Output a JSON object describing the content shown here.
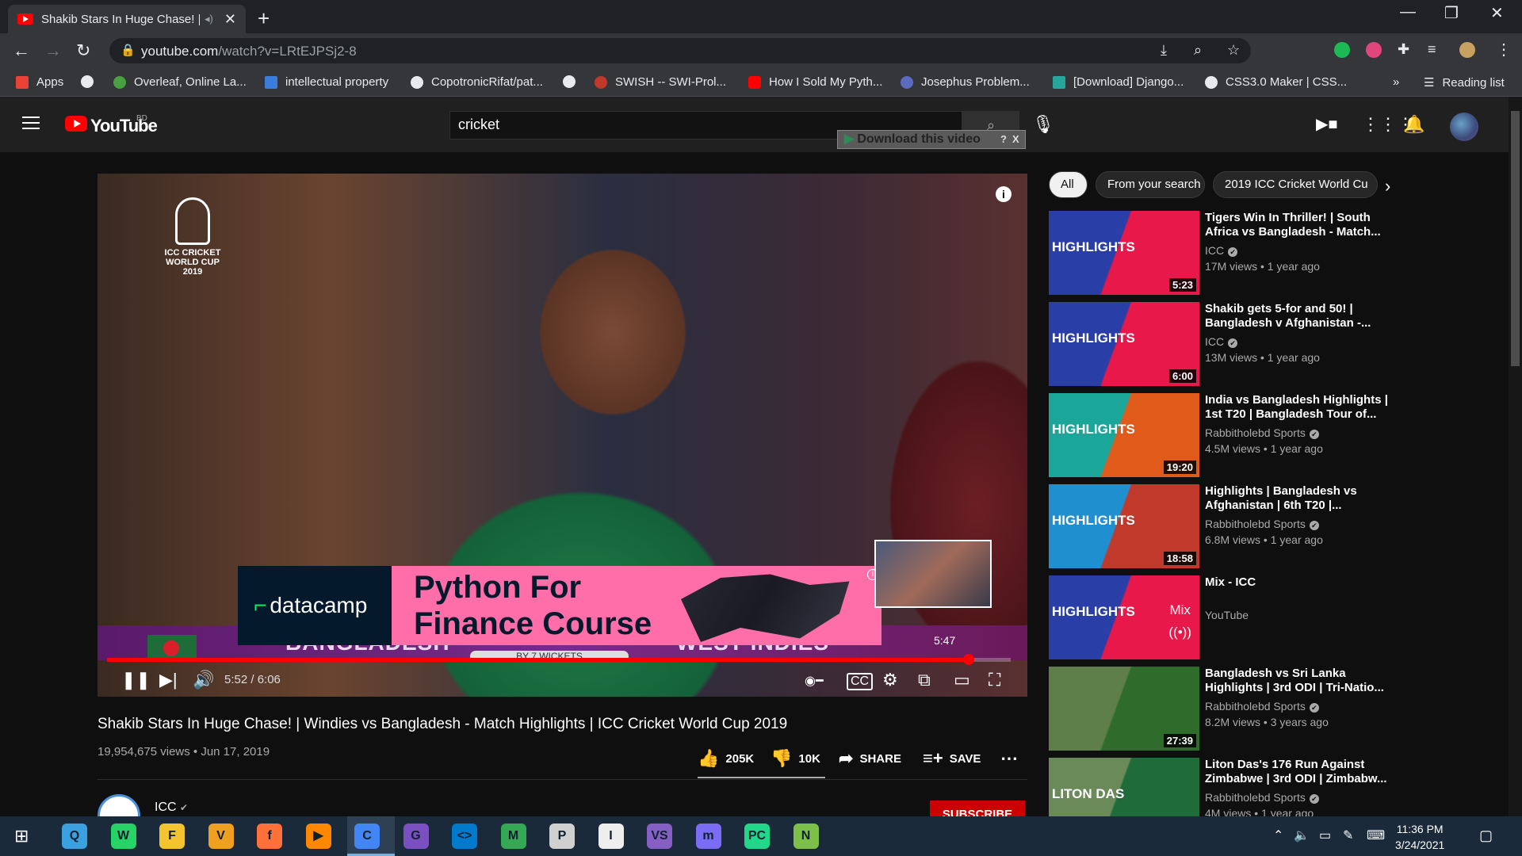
{
  "browser": {
    "tab_title": "Shakib Stars In Huge Chase! |",
    "url_host": "youtube.com",
    "url_path": "/watch?v=LRtEJPSj2-8",
    "bookmarks": [
      {
        "label": "Apps",
        "color": "#ea4335"
      },
      {
        "label": "",
        "color": "#e8eaed"
      },
      {
        "label": "Overleaf, Online La...",
        "color": "#47a141"
      },
      {
        "label": "intellectual property",
        "color": "#3b7ddd"
      },
      {
        "label": "CopotronicRifat/pat...",
        "color": "#e8eaed"
      },
      {
        "label": "",
        "color": "#e8eaed"
      },
      {
        "label": "SWISH -- SWI-Prol...",
        "color": "#c0392b"
      },
      {
        "label": "How I Sold My Pyth...",
        "color": "#ff0000"
      },
      {
        "label": "Josephus Problem...",
        "color": "#5c6bc0"
      },
      {
        "label": "[Download] Django...",
        "color": "#26a69a"
      },
      {
        "label": "CSS3.0 Maker | CSS...",
        "color": "#e8eaed"
      }
    ],
    "overflow_label": "»",
    "reading_list": "Reading list"
  },
  "youtube": {
    "logo_text": "YouTube",
    "country_code": "BD",
    "search_value": "cricket",
    "download_label": "Download this video",
    "download_help": "?",
    "download_close": "X"
  },
  "video": {
    "overlay_logo": [
      "ICC CRICKET",
      "WORLD CUP",
      "2019"
    ],
    "team_left": "BANGLADESH",
    "team_right": "WEST INDIES",
    "win_text": "BY 7 WICKETS",
    "ad_brand": "datacamp",
    "ad_headline_1": "Python For",
    "ad_headline_2": "Finance Course",
    "preview_time": "5:47",
    "current_time": "5:52",
    "duration": "6:06",
    "time_display": "5:52 / 6:06",
    "progress_fraction": 0.9536,
    "title": "Shakib Stars In Huge Chase! | Windies vs Bangladesh - Match Highlights | ICC Cricket World Cup 2019",
    "meta": "19,954,675 views • Jun 17, 2019",
    "likes": "205K",
    "dislikes": "10K",
    "share": "SHARE",
    "save": "SAVE",
    "channel": "ICC",
    "subscribe": "SUBSCRIBE"
  },
  "sidebar": {
    "chips": [
      "All",
      "From your search",
      "2019 ICC Cricket World Cu"
    ],
    "recommendations": [
      {
        "title": "Tigers Win In Thriller! | South Africa vs Bangladesh - Match...",
        "channel": "ICC",
        "verified": true,
        "meta": "17M views • 1 year ago",
        "duration": "5:23",
        "thumb_label": "HIGHLIGHTS",
        "bg": "#2a3ea8",
        "accent": "#e8194a"
      },
      {
        "title": "Shakib gets 5-for and 50! | Bangladesh v Afghanistan -...",
        "channel": "ICC",
        "verified": true,
        "meta": "13M views • 1 year ago",
        "duration": "6:00",
        "thumb_label": "HIGHLIGHTS",
        "bg": "#2a3ea8",
        "accent": "#e8194a"
      },
      {
        "title": "India vs Bangladesh Highlights | 1st T20 | Bangladesh Tour of...",
        "channel": "Rabbitholebd Sports",
        "verified": true,
        "meta": "4.5M views • 1 year ago",
        "duration": "19:20",
        "thumb_label": "HIGHLIGHTS",
        "bg": "#1aa79a",
        "accent": "#e05a1a"
      },
      {
        "title": "Highlights | Bangladesh vs Afghanistan | 6th T20 |...",
        "channel": "Rabbitholebd Sports",
        "verified": true,
        "meta": "6.8M views • 1 year ago",
        "duration": "18:58",
        "thumb_label": "HIGHLIGHTS",
        "bg": "#1f8fd0",
        "accent": "#c0392b"
      },
      {
        "title": "Mix - ICC",
        "channel": "YouTube",
        "verified": false,
        "meta": "",
        "duration": "",
        "thumb_label": "HIGHLIGHTS",
        "bg": "#2a3ea8",
        "accent": "#e8194a",
        "mix": "Mix"
      },
      {
        "title": "Bangladesh vs Sri Lanka Highlights | 3rd ODI | Tri-Natio...",
        "channel": "Rabbitholebd Sports",
        "verified": true,
        "meta": "8.2M views • 3 years ago",
        "duration": "27:39",
        "thumb_label": "",
        "bg": "#5f7f4a",
        "accent": "#2f6b2a"
      },
      {
        "title": "Liton Das's 176 Run Against Zimbabwe | 3rd ODI | Zimbabw...",
        "channel": "Rabbitholebd Sports",
        "verified": true,
        "meta": "4M views • 1 year ago",
        "duration": "",
        "thumb_label": "LITON DAS",
        "bg": "#6a8a5a",
        "accent": "#1f6b3a"
      }
    ]
  },
  "taskbar": {
    "apps": [
      {
        "name": "quick-assist",
        "color": "#3aa0e0",
        "glyph": "Q"
      },
      {
        "name": "whatsapp",
        "color": "#25d366",
        "glyph": "W"
      },
      {
        "name": "file-explorer",
        "color": "#f4c430",
        "glyph": "F"
      },
      {
        "name": "vpn",
        "color": "#f0a020",
        "glyph": "V"
      },
      {
        "name": "firefox",
        "color": "#ff7139",
        "glyph": "f"
      },
      {
        "name": "vlc",
        "color": "#ff8800",
        "glyph": "▶"
      },
      {
        "name": "chrome",
        "color": "#4285f4",
        "glyph": "C"
      },
      {
        "name": "github-desktop",
        "color": "#7a4fc0",
        "glyph": "G"
      },
      {
        "name": "vscode",
        "color": "#007acc",
        "glyph": "<>"
      },
      {
        "name": "maps",
        "color": "#34a853",
        "glyph": "M"
      },
      {
        "name": "paint",
        "color": "#d0d0d0",
        "glyph": "P"
      },
      {
        "name": "inkscape",
        "color": "#eeeeee",
        "glyph": "I"
      },
      {
        "name": "visual-studio",
        "color": "#865fc5",
        "glyph": "VS"
      },
      {
        "name": "messenger",
        "color": "#7b6cf6",
        "glyph": "m"
      },
      {
        "name": "pycharm",
        "color": "#21d789",
        "glyph": "PC"
      },
      {
        "name": "notepad",
        "color": "#7cc04a",
        "glyph": "N"
      }
    ],
    "time": "11:36 PM",
    "date": "3/24/2021"
  }
}
